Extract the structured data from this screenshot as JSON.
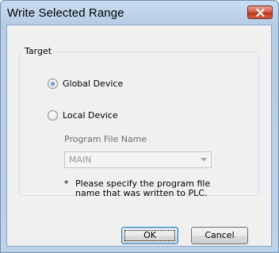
{
  "dialog": {
    "title": "Write Selected Range",
    "close_icon": "close-x-icon"
  },
  "target_group": {
    "legend": "Target",
    "options": [
      {
        "label": "Global Device",
        "selected": true
      },
      {
        "label": "Local Device",
        "selected": false
      }
    ],
    "program_file_name_label": "Program File Name",
    "program_file_select": {
      "value": "MAIN",
      "enabled": false
    },
    "note_marker": "*",
    "note_text": "Please specify the program file name that was written to PLC."
  },
  "buttons": {
    "ok_label": "OK",
    "cancel_label": "Cancel"
  },
  "colors": {
    "title_bar": "#bcd2ea",
    "close_button": "#c7432c",
    "client_background": "#f0f0f0",
    "radio_selected": "#1d5fa6"
  }
}
